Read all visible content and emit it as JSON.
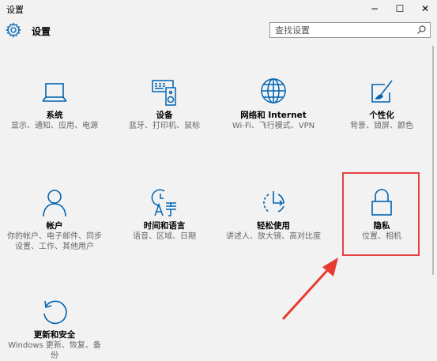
{
  "window": {
    "title": "设置",
    "minimize_glyph": "−",
    "maximize_glyph": "☐",
    "close_glyph": "✕"
  },
  "header": {
    "title": "设置",
    "icon": "gear-icon"
  },
  "search": {
    "placeholder": "查找设置",
    "icon": "search-icon"
  },
  "tiles": [
    {
      "name": "系统",
      "description": "显示、通知、应用、电源",
      "icon": "laptop-icon"
    },
    {
      "name": "设备",
      "description": "蓝牙、打印机、鼠标",
      "icon": "devices-icon"
    },
    {
      "name": "网络和 Internet",
      "description": "Wi-Fi、飞行模式、VPN",
      "icon": "globe-icon"
    },
    {
      "name": "个性化",
      "description": "背景、锁屏、颜色",
      "icon": "personalization-icon"
    },
    {
      "name": "帐户",
      "description": "你的帐户、电子邮件、同步设置、工作、其他用户",
      "icon": "person-icon"
    },
    {
      "name": "时间和语言",
      "description": "语音、区域、日期",
      "icon": "time-language-icon"
    },
    {
      "name": "轻松使用",
      "description": "讲述人、放大镜、高对比度",
      "icon": "ease-of-access-icon"
    },
    {
      "name": "隐私",
      "description": "位置、相机",
      "icon": "lock-icon"
    },
    {
      "name": "更新和安全",
      "description": "Windows 更新、恢复、备份",
      "icon": "update-icon"
    }
  ],
  "colors": {
    "accent": "#0063b1",
    "background": "#f2f2f2",
    "highlight_border": "#e84040",
    "arrow": "#e83a30"
  }
}
